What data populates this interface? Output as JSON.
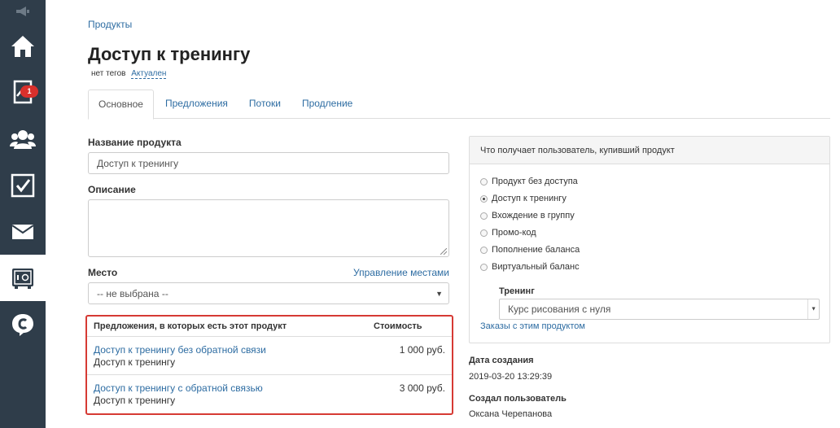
{
  "sidebar": {
    "badge_count": "1",
    "items": [
      {
        "icon": "home-icon"
      },
      {
        "icon": "chart-icon"
      },
      {
        "icon": "users-icon"
      },
      {
        "icon": "tasks-icon"
      },
      {
        "icon": "mail-icon"
      },
      {
        "icon": "safe-icon"
      },
      {
        "icon": "chat-icon"
      }
    ]
  },
  "breadcrumb": "Продукты",
  "page_title": "Доступ к тренингу",
  "tags": {
    "no_tags": "нет тегов",
    "status": "Актуален"
  },
  "tabs": [
    {
      "label": "Основное",
      "active": true
    },
    {
      "label": "Предложения"
    },
    {
      "label": "Потоки"
    },
    {
      "label": "Продление"
    }
  ],
  "form": {
    "name_label": "Название продукта",
    "name_value": "Доступ к тренингу",
    "description_label": "Описание",
    "description_value": "",
    "place_label": "Место",
    "place_manage_link": "Управление местами",
    "place_value": "-- не выбрана --"
  },
  "offers": {
    "col_name": "Предложения, в которых есть этот продукт",
    "col_price": "Стоимость",
    "rows": [
      {
        "title": "Доступ к тренингу без обратной связи",
        "product": "Доступ к тренингу",
        "price": "1 000 руб."
      },
      {
        "title": "Доступ к тренингу с обратной связью",
        "product": "Доступ к тренингу",
        "price": "3 000 руб."
      }
    ]
  },
  "access_panel": {
    "title": "Что получает пользователь, купивший продукт",
    "options": [
      {
        "label": "Продукт без доступа",
        "checked": false
      },
      {
        "label": "Доступ к тренингу",
        "checked": true
      },
      {
        "label": "Вхождение в группу",
        "checked": false
      },
      {
        "label": "Промо-код",
        "checked": false
      },
      {
        "label": "Пополнение баланса",
        "checked": false
      },
      {
        "label": "Виртуальный баланс",
        "checked": false
      }
    ],
    "training_label": "Тренинг",
    "training_value": "Курс рисования с нуля",
    "orders_link": "Заказы с этим продуктом"
  },
  "meta": {
    "created_label": "Дата создания",
    "created_value": "2019-03-20 13:29:39",
    "creator_label": "Создал пользователь",
    "creator_value": "Оксана Черепанова"
  },
  "colors": {
    "sidebar_bg": "#2f3d4a",
    "link": "#2d6ca2",
    "highlight_border": "#d63a34",
    "badge": "#d9302c"
  }
}
